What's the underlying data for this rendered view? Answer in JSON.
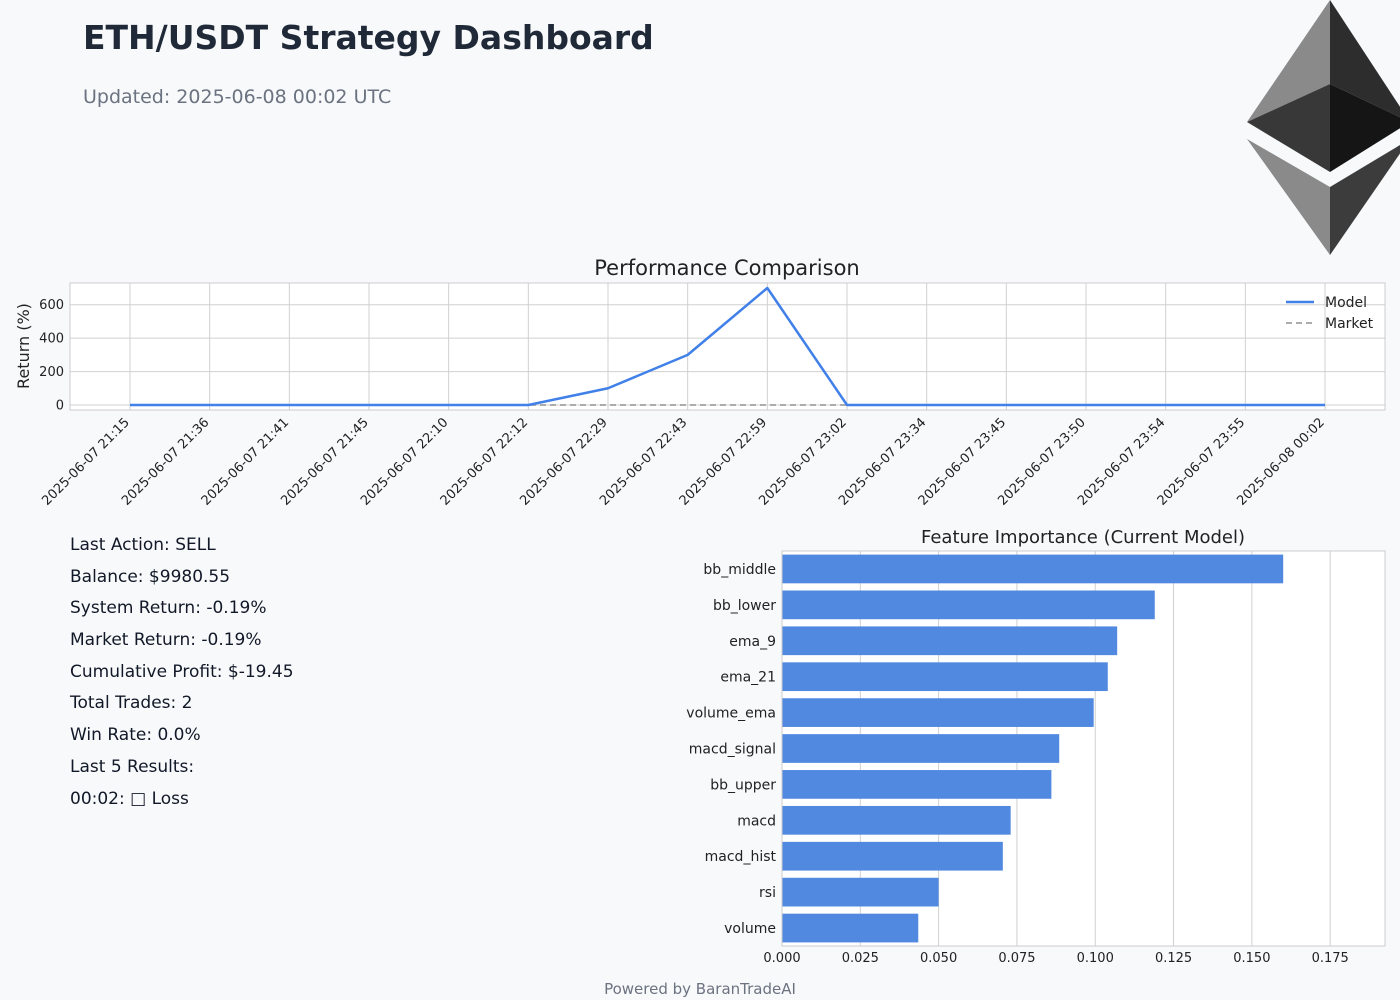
{
  "header": {
    "title": "ETH/USDT Strategy Dashboard",
    "updated": "Updated: 2025-06-08 00:02 UTC"
  },
  "logo": {
    "icon": "ethereum-icon"
  },
  "colors": {
    "model": "#4080e8",
    "market": "#a0a0a0",
    "bar": "#5289e0",
    "grid": "#d0d0d0"
  },
  "chart_data": [
    {
      "type": "line",
      "title": "Performance Comparison",
      "xlabel": "",
      "ylabel": "Return (%)",
      "x": [
        "2025-06-07 21:15",
        "2025-06-07 21:36",
        "2025-06-07 21:41",
        "2025-06-07 21:45",
        "2025-06-07 22:10",
        "2025-06-07 22:12",
        "2025-06-07 22:29",
        "2025-06-07 22:43",
        "2025-06-07 22:59",
        "2025-06-07 23:02",
        "2025-06-07 23:34",
        "2025-06-07 23:45",
        "2025-06-07 23:50",
        "2025-06-07 23:54",
        "2025-06-07 23:55",
        "2025-06-08 00:02"
      ],
      "series": [
        {
          "name": "Model",
          "values": [
            0,
            0,
            0,
            0,
            0,
            0,
            100,
            300,
            700,
            0,
            0,
            0,
            0,
            0,
            0,
            0
          ]
        },
        {
          "name": "Market",
          "values": [
            0,
            0,
            0,
            0,
            0,
            0,
            0,
            0,
            0,
            0,
            0,
            0,
            0,
            0,
            0,
            0
          ]
        }
      ],
      "yticks": [
        0,
        200,
        400,
        600
      ],
      "ylim": [
        -30,
        730
      ],
      "grid": true,
      "legend": "top-right"
    },
    {
      "type": "bar",
      "orientation": "horizontal",
      "title": "Feature Importance (Current Model)",
      "categories": [
        "bb_middle",
        "bb_lower",
        "ema_9",
        "ema_21",
        "volume_ema",
        "macd_signal",
        "bb_upper",
        "macd",
        "macd_hist",
        "rsi",
        "volume"
      ],
      "values": [
        0.16,
        0.119,
        0.107,
        0.104,
        0.0995,
        0.0885,
        0.086,
        0.073,
        0.0705,
        0.05,
        0.0435
      ],
      "xticks": [
        "0.000",
        "0.025",
        "0.050",
        "0.075",
        "0.100",
        "0.125",
        "0.150",
        "0.175"
      ],
      "xlim": [
        0,
        0.1925
      ],
      "grid": true
    }
  ],
  "stats": [
    "Last Action: SELL",
    "Balance: $9980.55",
    "System Return: -0.19%",
    "Market Return: -0.19%",
    "Cumulative Profit: $-19.45",
    "Total Trades: 2",
    "Win Rate: 0.0%",
    "Last 5 Results:",
    "00:02: □ Loss"
  ],
  "footer": "Powered by BaranTradeAI"
}
